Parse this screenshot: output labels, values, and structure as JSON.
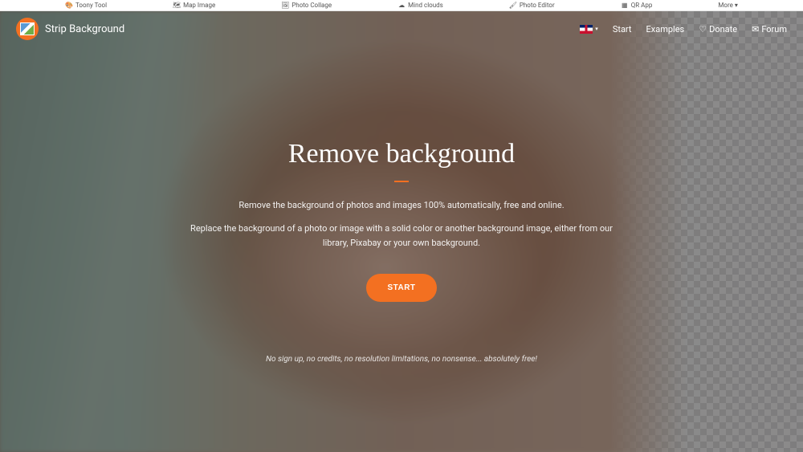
{
  "toolbar": {
    "items": [
      {
        "icon": "🎨",
        "label": "Toony Tool"
      },
      {
        "icon": "🗺",
        "label": "Map Image"
      },
      {
        "icon": "🖼",
        "label": "Photo Collage"
      },
      {
        "icon": "☁",
        "label": "Mind clouds"
      },
      {
        "icon": "🖌",
        "label": "Photo Editor"
      },
      {
        "icon": "▦",
        "label": "QR App"
      }
    ],
    "more_label": "More"
  },
  "header": {
    "brand": "Strip Background",
    "nav": {
      "start": "Start",
      "examples": "Examples",
      "donate": "Donate",
      "forum": "Forum"
    }
  },
  "hero": {
    "title": "Remove background",
    "description1": "Remove the background of photos and images 100% automatically, free and online.",
    "description2": "Replace the background of a photo or image with a solid color or another background image, either from our library, Pixabay or your own background.",
    "start_button": "START",
    "tagline": "No sign up, no credits, no resolution limitations, no nonsense... absolutely free!"
  },
  "colors": {
    "accent": "#f37021"
  }
}
